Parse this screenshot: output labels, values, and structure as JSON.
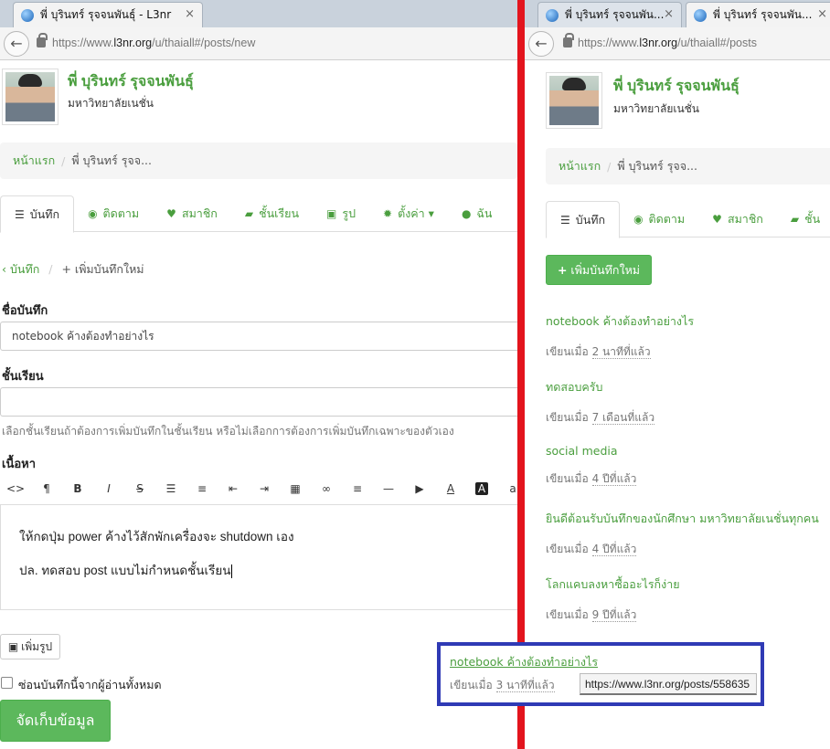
{
  "left": {
    "tab": {
      "title": "พี่ บุรินทร์ รุจจนพันธุ์ - L3nr",
      "close": "×"
    },
    "url": {
      "prefix": "https://www.",
      "domain": "l3nr.org",
      "path": "/u/thaiall#/posts/new"
    },
    "profile": {
      "name": "พี่ บุรินทร์ รุจจนพันธุ์",
      "school": "มหาวิทยาลัยเนชั่น"
    },
    "breadcrumb": {
      "home": "หน้าแรก",
      "current": "พี่ บุรินทร์ รุจจ..."
    },
    "nav": [
      {
        "icon": "☰",
        "icon_name": "list-icon",
        "label": "บันทึก"
      },
      {
        "icon": "◉",
        "icon_name": "eye-icon",
        "label": "ติดตาม"
      },
      {
        "icon": "♥",
        "icon_name": "heart-icon",
        "label": "สมาชิก"
      },
      {
        "icon": "▰",
        "icon_name": "book-icon",
        "label": "ชั้นเรียน"
      },
      {
        "icon": "▣",
        "icon_name": "image-icon",
        "label": "รูป"
      },
      {
        "icon": "✹",
        "icon_name": "gear-icon",
        "label": "ตั้งค่า ▾"
      },
      {
        "icon": "●",
        "icon_name": "user-icon",
        "label": "ฉัน"
      }
    ],
    "subcrumb": {
      "back": "บันทึก",
      "current": "เพิ่มบันทึกใหม่"
    },
    "form": {
      "title_label": "ชื่อบันทึก",
      "title_value": "notebook ค้างต้องทำอย่างไร",
      "class_label": "ชั้นเรียน",
      "class_value": "",
      "class_help": "เลือกชั้นเรียนถ้าต้องการเพิ่มบันทึกในชั้นเรียน หรือไม่เลือกการต้องการเพิ่มบันทึกเฉพาะของตัวเอง",
      "content_label": "เนื้อหา",
      "toolbar": [
        {
          "glyph": "<>",
          "name": "code-icon"
        },
        {
          "glyph": "¶",
          "name": "paragraph-icon"
        },
        {
          "glyph": "B",
          "name": "bold-icon"
        },
        {
          "glyph": "I",
          "name": "italic-icon"
        },
        {
          "glyph": "S",
          "name": "strikethrough-icon"
        },
        {
          "glyph": "☰",
          "name": "bullet-list-icon"
        },
        {
          "glyph": "≡",
          "name": "numbered-list-icon"
        },
        {
          "glyph": "⇤",
          "name": "outdent-icon"
        },
        {
          "glyph": "⇥",
          "name": "indent-icon"
        },
        {
          "glyph": "▦",
          "name": "table-icon"
        },
        {
          "glyph": "∞",
          "name": "link-icon"
        },
        {
          "glyph": "≡",
          "name": "align-icon"
        },
        {
          "glyph": "—",
          "name": "horizontal-rule-icon"
        },
        {
          "glyph": "▶",
          "name": "video-icon"
        },
        {
          "glyph": "A",
          "name": "font-color-icon"
        },
        {
          "glyph": "A",
          "name": "background-color-icon"
        },
        {
          "glyph": "a",
          "name": "font-size-icon"
        }
      ],
      "content_lines": [
        "ให้กดปุ่ม power ค้างไว้สักพักเครื่องจะ shutdown เอง",
        "ปล. ทดสอบ post แบบไม่กำหนดชั้นเรียน"
      ],
      "add_image": "เพิ่มรูป",
      "hide_label": "ซ่อนบันทึกนี้จากผู้อ่านทั้งหมด",
      "submit": "จัดเก็บข้อมูล"
    }
  },
  "right": {
    "tabs": [
      {
        "title": "พี่ บุรินทร์ รุจจนพัน...",
        "close": "×"
      },
      {
        "title": "พี่ บุรินทร์ รุจจนพัน...",
        "close": "×"
      }
    ],
    "url": {
      "prefix": "https://www.",
      "domain": "l3nr.org",
      "path": "/u/thaiall#/posts"
    },
    "profile": {
      "name": "พี่ บุรินทร์ รุจจนพันธุ์",
      "school": "มหาวิทยาลัยเนชั่น"
    },
    "breadcrumb": {
      "home": "หน้าแรก",
      "current": "พี่ บุรินทร์ รุจจ..."
    },
    "nav": [
      {
        "icon": "☰",
        "icon_name": "list-icon",
        "label": "บันทึก"
      },
      {
        "icon": "◉",
        "icon_name": "eye-icon",
        "label": "ติดตาม"
      },
      {
        "icon": "♥",
        "icon_name": "heart-icon",
        "label": "สมาชิก"
      },
      {
        "icon": "▰",
        "icon_name": "book-icon",
        "label": "ชั้น"
      }
    ],
    "new_post_button": "เพิ่มบันทึกใหม่",
    "written_prefix": "เขียนเมื่อ",
    "posts": [
      {
        "title": "notebook ค้างต้องทำอย่างไร",
        "time": "2 นาทีที่แล้ว"
      },
      {
        "title": "ทดสอบครับ",
        "time": "7 เดือนที่แล้ว"
      },
      {
        "title": "social media",
        "time": "4 ปีที่แล้ว"
      },
      {
        "title": "ยินดีต้อนรับบันทึกของนักศึกษา มหาวิทยาลัยเนชั่นทุกคน",
        "time": "4 ปีที่แล้ว"
      },
      {
        "title": "โลกแคบลงหาซื้ออะไรก็ง่าย",
        "time": "9 ปีที่แล้ว"
      }
    ]
  },
  "highlight": {
    "title": "notebook ค้างต้องทำอย่างไร",
    "written_prefix": "เขียนเมื่อ",
    "time": "3 นาทีที่แล้ว",
    "tooltip_url": "https://www.l3nr.org/posts/558635"
  },
  "colors": {
    "accent_green": "#4a9e3e",
    "divider_red": "#e3141d",
    "highlight_blue": "#2f3ab5",
    "button_green": "#5cb85c"
  }
}
